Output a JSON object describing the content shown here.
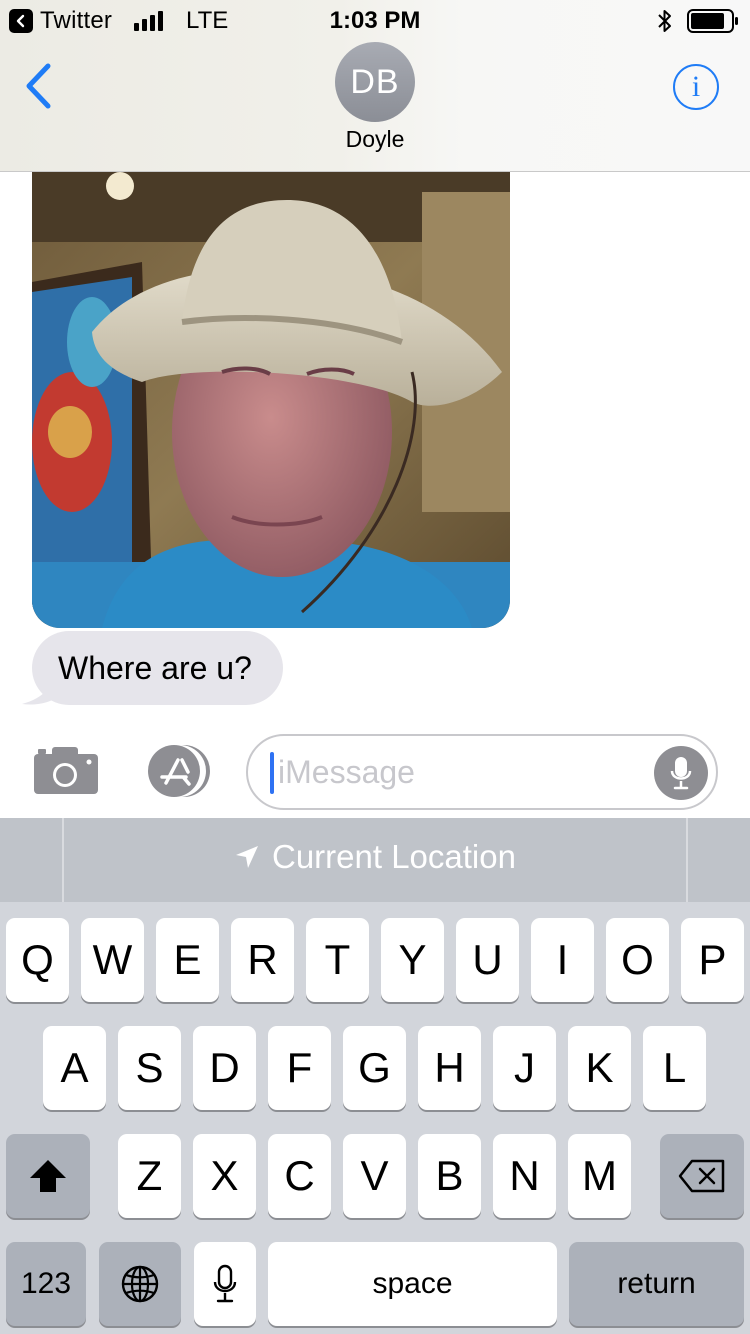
{
  "status_bar": {
    "back_app_label": "Twitter",
    "carrier": "LTE",
    "time": "1:03 PM",
    "icons": [
      "back-chevron-icon",
      "signal-bars-icon",
      "bluetooth-icon",
      "battery-icon"
    ]
  },
  "header": {
    "avatar_initials": "DB",
    "contact_name": "Doyle",
    "info_icon_glyph": "i",
    "back_icon": "chevron-left-icon"
  },
  "conversation": {
    "messages": [
      {
        "type": "image",
        "direction": "incoming",
        "description_icon": "photo"
      },
      {
        "type": "text",
        "direction": "incoming",
        "text": "Where are u?"
      }
    ]
  },
  "compose": {
    "placeholder": "iMessage",
    "icons": [
      "camera-icon",
      "app-store-icon",
      "microphone-icon"
    ]
  },
  "keyboard": {
    "suggestion": "Current Location",
    "row1": [
      "Q",
      "W",
      "E",
      "R",
      "T",
      "Y",
      "U",
      "I",
      "O",
      "P"
    ],
    "row2": [
      "A",
      "S",
      "D",
      "F",
      "G",
      "H",
      "J",
      "K",
      "L"
    ],
    "row3": [
      "Z",
      "X",
      "C",
      "V",
      "B",
      "N",
      "M"
    ],
    "numbers_label": "123",
    "space_label": "space",
    "return_label": "return"
  },
  "colors": {
    "accent": "#1f7cf6",
    "incoming_bubble": "#e6e5eb",
    "keyboard_bg": "#d2d5db",
    "function_key": "#acb1ba"
  }
}
